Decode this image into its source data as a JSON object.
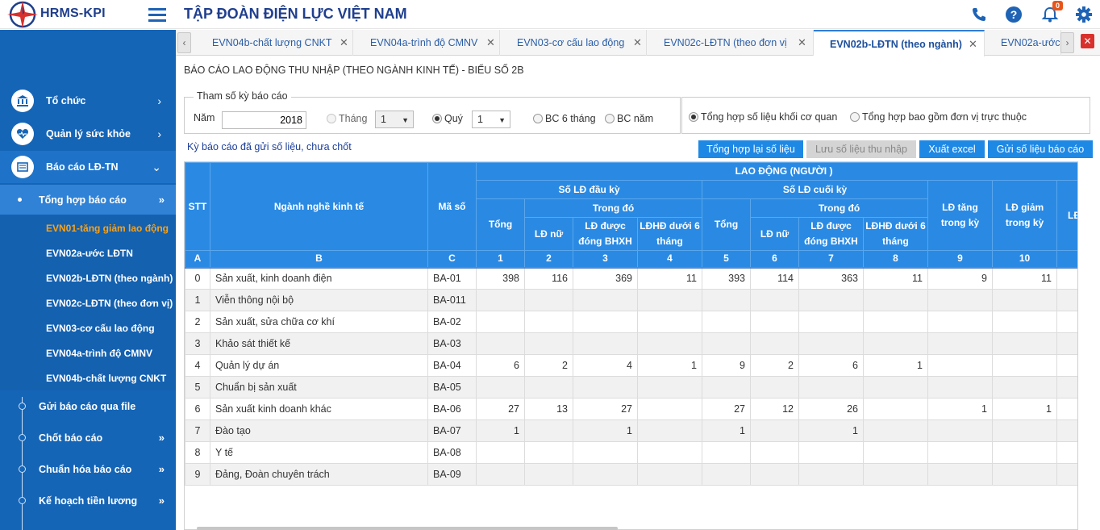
{
  "app": {
    "logo_text": "HRMS-KPI",
    "title": "TẬP ĐOÀN ĐIỆN LỰC VIỆT NAM",
    "notifications": "0"
  },
  "header_icons": [
    "phone-icon",
    "help-icon",
    "bell-icon",
    "gear-icon"
  ],
  "sidebar": {
    "items": [
      {
        "label": "Tổ chức",
        "icon": "bank-icon"
      },
      {
        "label": "Quản lý sức khỏe",
        "icon": "heart-icon"
      },
      {
        "label": "Báo cáo LĐ-TN",
        "icon": "report-icon"
      }
    ],
    "submenu_label": "Tổng hợp báo cáo",
    "leaves": [
      "EVN01-tăng giảm lao động",
      "EVN02a-ước LĐTN",
      "EVN02b-LĐTN (theo ngành)",
      "EVN02c-LĐTN (theo đơn vị)",
      "EVN03-cơ cấu lao động",
      "EVN04a-trình độ CMNV",
      "EVN04b-chất lượng CNKT"
    ],
    "bottom_items": [
      "Gửi báo cáo qua file",
      "Chốt báo cáo",
      "Chuẩn hóa báo cáo",
      "Kế hoạch tiền lương"
    ]
  },
  "tabs": [
    {
      "label": "EVN04b-chất lượng CNKT"
    },
    {
      "label": "EVN04a-trình độ CMNV"
    },
    {
      "label": "EVN03-cơ cấu lao động"
    },
    {
      "label": "EVN02c-LĐTN (theo đơn vị"
    },
    {
      "label": "EVN02b-LĐTN (theo ngành)",
      "active": true
    },
    {
      "label": "EVN02a-ước"
    }
  ],
  "report": {
    "title": "BÁO CÁO LAO ĐỘNG THU NHẬP (THEO NGÀNH KINH TẾ) - BIỂU SỐ 2B",
    "param_legend": "Tham số kỳ báo cáo",
    "year_label": "Năm",
    "year_value": "2018",
    "month_label": "Tháng",
    "month_value": "1",
    "quarter_label": "Quý",
    "quarter_value": "1",
    "half_label": "BC 6 tháng",
    "annual_label": "BC năm",
    "scope_office": "Tổng hợp số liệu khối cơ quan",
    "scope_all": "Tổng hợp bao gồm đơn vị trực thuộc",
    "status_note": "Kỳ báo cáo đã gửi số liệu, chưa chốt",
    "btn_resum": "Tổng hợp lại số liệu",
    "btn_save_income": "Lưu số liệu thu nhập",
    "btn_export": "Xuất excel",
    "btn_send": "Gửi số liệu báo cáo"
  },
  "table": {
    "h_stt": "STT",
    "h_sector": "Ngành nghề kinh tế",
    "h_code": "Mã số",
    "h_labor": "LAO ĐỘNG (NGƯỜI )",
    "h_start": "Số LĐ đầu kỳ",
    "h_end": "Số LĐ cuối kỳ",
    "h_total": "Tổng",
    "h_of_which": "Trong đó",
    "h_female": "LĐ nữ",
    "h_bhxh": "LĐ được đóng BHXH",
    "h_short": "LĐHĐ dưới 6 tháng",
    "h_incr": "LĐ tăng trong kỳ",
    "h_decr": "LĐ giảm trong kỳ",
    "h_more": "LĐ",
    "index_row": [
      "A",
      "B",
      "C",
      "1",
      "2",
      "3",
      "4",
      "5",
      "6",
      "7",
      "8",
      "9",
      "10",
      ""
    ],
    "rows": [
      [
        "0",
        "Sản xuất, kinh doanh điện",
        "BA-01",
        "398",
        "116",
        "369",
        "11",
        "393",
        "114",
        "363",
        "11",
        "9",
        "11",
        ""
      ],
      [
        "1",
        "Viễn thông nội bộ",
        "BA-011",
        "",
        "",
        "",
        "",
        "",
        "",
        "",
        "",
        "",
        "",
        ""
      ],
      [
        "2",
        "Sản xuất, sửa chữa cơ khí",
        "BA-02",
        "",
        "",
        "",
        "",
        "",
        "",
        "",
        "",
        "",
        "",
        ""
      ],
      [
        "3",
        "Khảo sát thiết kế",
        "BA-03",
        "",
        "",
        "",
        "",
        "",
        "",
        "",
        "",
        "",
        "",
        ""
      ],
      [
        "4",
        "Quản lý dự án",
        "BA-04",
        "6",
        "2",
        "4",
        "1",
        "9",
        "2",
        "6",
        "1",
        "",
        "",
        ""
      ],
      [
        "5",
        "Chuẩn bị sản xuất",
        "BA-05",
        "",
        "",
        "",
        "",
        "",
        "",
        "",
        "",
        "",
        "",
        ""
      ],
      [
        "6",
        "Sản xuất kinh doanh khác",
        "BA-06",
        "27",
        "13",
        "27",
        "",
        "27",
        "12",
        "26",
        "",
        "1",
        "1",
        ""
      ],
      [
        "7",
        "Đào tạo",
        "BA-07",
        "1",
        "",
        "1",
        "",
        "1",
        "",
        "1",
        "",
        "",
        "",
        ""
      ],
      [
        "8",
        "Y tế",
        "BA-08",
        "",
        "",
        "",
        "",
        "",
        "",
        "",
        "",
        "",
        "",
        ""
      ],
      [
        "9",
        "Đảng, Đoàn chuyên trách",
        "BA-09",
        "",
        "",
        "",
        "",
        "",
        "",
        "",
        "",
        "",
        "",
        ""
      ]
    ]
  }
}
